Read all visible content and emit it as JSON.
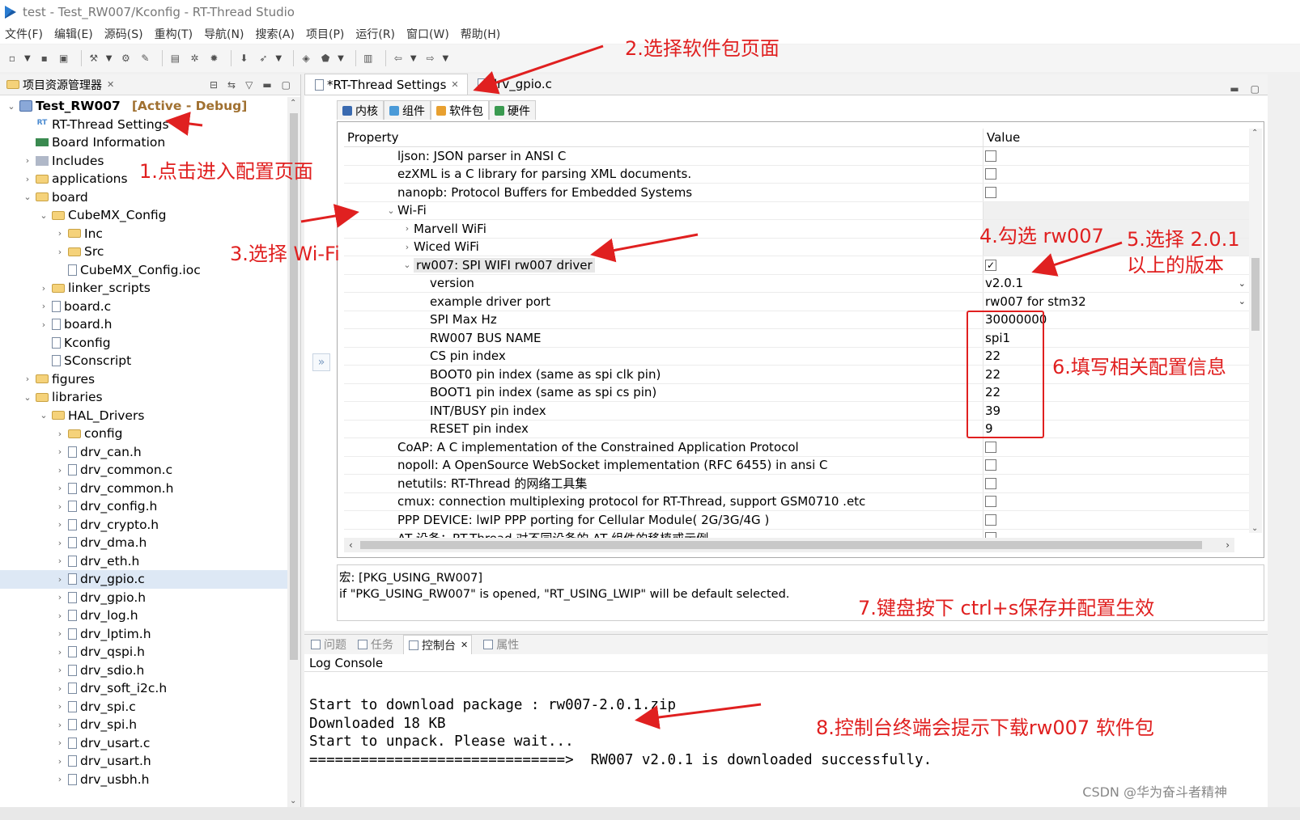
{
  "window": {
    "title": "test - Test_RW007/Kconfig - RT-Thread Studio"
  },
  "menubar": [
    "文件(F)",
    "编辑(E)",
    "源码(S)",
    "重构(T)",
    "导航(N)",
    "搜索(A)",
    "项目(P)",
    "运行(R)",
    "窗口(W)",
    "帮助(H)"
  ],
  "explorer": {
    "title": "项目资源管理器",
    "project_name": "Test_RW007",
    "project_tag": "[Active - Debug]",
    "items": [
      {
        "label": "RT-Thread Settings",
        "icon": "rt-settings-icon",
        "depth": 1,
        "twist": ""
      },
      {
        "label": "Board Information",
        "icon": "board-info-icon",
        "depth": 1,
        "twist": ""
      },
      {
        "label": "Includes",
        "icon": "includes-icon",
        "depth": 1,
        "twist": "›"
      },
      {
        "label": "applications",
        "icon": "folder-icon",
        "depth": 1,
        "twist": "›"
      },
      {
        "label": "board",
        "icon": "folder-icon",
        "depth": 1,
        "twist": "⌄"
      },
      {
        "label": "CubeMX_Config",
        "icon": "folder-icon",
        "depth": 2,
        "twist": "⌄"
      },
      {
        "label": "Inc",
        "icon": "folder-icon",
        "depth": 3,
        "twist": "›"
      },
      {
        "label": "Src",
        "icon": "folder-icon",
        "depth": 3,
        "twist": "›"
      },
      {
        "label": "CubeMX_Config.ioc",
        "icon": "file-icon",
        "depth": 3,
        "twist": ""
      },
      {
        "label": "linker_scripts",
        "icon": "folder-icon",
        "depth": 2,
        "twist": "›"
      },
      {
        "label": "board.c",
        "icon": "file-icon",
        "depth": 2,
        "twist": "›"
      },
      {
        "label": "board.h",
        "icon": "file-icon",
        "depth": 2,
        "twist": "›"
      },
      {
        "label": "Kconfig",
        "icon": "file-icon",
        "depth": 2,
        "twist": ""
      },
      {
        "label": "SConscript",
        "icon": "file-icon",
        "depth": 2,
        "twist": ""
      },
      {
        "label": "figures",
        "icon": "folder-icon",
        "depth": 1,
        "twist": "›"
      },
      {
        "label": "libraries",
        "icon": "folder-icon",
        "depth": 1,
        "twist": "⌄"
      },
      {
        "label": "HAL_Drivers",
        "icon": "folder-icon",
        "depth": 2,
        "twist": "⌄"
      },
      {
        "label": "config",
        "icon": "folder-icon",
        "depth": 3,
        "twist": "›"
      },
      {
        "label": "drv_can.h",
        "icon": "file-icon",
        "depth": 3,
        "twist": "›"
      },
      {
        "label": "drv_common.c",
        "icon": "file-icon",
        "depth": 3,
        "twist": "›"
      },
      {
        "label": "drv_common.h",
        "icon": "file-icon",
        "depth": 3,
        "twist": "›"
      },
      {
        "label": "drv_config.h",
        "icon": "file-icon",
        "depth": 3,
        "twist": "›"
      },
      {
        "label": "drv_crypto.h",
        "icon": "file-icon",
        "depth": 3,
        "twist": "›"
      },
      {
        "label": "drv_dma.h",
        "icon": "file-icon",
        "depth": 3,
        "twist": "›"
      },
      {
        "label": "drv_eth.h",
        "icon": "file-icon",
        "depth": 3,
        "twist": "›"
      },
      {
        "label": "drv_gpio.c",
        "icon": "file-icon",
        "depth": 3,
        "twist": "›",
        "selected": true
      },
      {
        "label": "drv_gpio.h",
        "icon": "file-icon",
        "depth": 3,
        "twist": "›"
      },
      {
        "label": "drv_log.h",
        "icon": "file-icon",
        "depth": 3,
        "twist": "›"
      },
      {
        "label": "drv_lptim.h",
        "icon": "file-icon",
        "depth": 3,
        "twist": "›"
      },
      {
        "label": "drv_qspi.h",
        "icon": "file-icon",
        "depth": 3,
        "twist": "›"
      },
      {
        "label": "drv_sdio.h",
        "icon": "file-icon",
        "depth": 3,
        "twist": "›"
      },
      {
        "label": "drv_soft_i2c.h",
        "icon": "file-icon",
        "depth": 3,
        "twist": "›"
      },
      {
        "label": "drv_spi.c",
        "icon": "file-icon",
        "depth": 3,
        "twist": "›"
      },
      {
        "label": "drv_spi.h",
        "icon": "file-icon",
        "depth": 3,
        "twist": "›"
      },
      {
        "label": "drv_usart.c",
        "icon": "file-icon",
        "depth": 3,
        "twist": "›"
      },
      {
        "label": "drv_usart.h",
        "icon": "file-icon",
        "depth": 3,
        "twist": "›"
      },
      {
        "label": "drv_usbh.h",
        "icon": "file-icon",
        "depth": 3,
        "twist": "›"
      }
    ]
  },
  "editor": {
    "tabs": [
      {
        "label": "*RT-Thread Settings",
        "active": true
      },
      {
        "label": "drv_gpio.c",
        "active": false
      }
    ],
    "sub_tabs": [
      {
        "label": "内核",
        "color": "#3a6ab0"
      },
      {
        "label": "组件",
        "color": "#4a9ad8"
      },
      {
        "label": "软件包",
        "color": "#e8a030",
        "active": true
      },
      {
        "label": "硬件",
        "color": "#3a9a50"
      }
    ],
    "prop_header": {
      "property": "Property",
      "value": "Value"
    },
    "rows": [
      {
        "label": "ljson: JSON parser in ANSI C",
        "indent": 2,
        "value_type": "checkbox",
        "checked": false
      },
      {
        "label": "ezXML is a C library for parsing XML documents.",
        "indent": 2,
        "value_type": "checkbox",
        "checked": false
      },
      {
        "label": "nanopb: Protocol Buffers for Embedded Systems",
        "indent": 2,
        "value_type": "checkbox",
        "checked": false
      },
      {
        "label": "Wi-Fi",
        "indent": 2,
        "twist": "⌄",
        "value_type": "grey"
      },
      {
        "label": "Marvell WiFi",
        "indent": 3,
        "twist": "›",
        "value_type": "grey"
      },
      {
        "label": "Wiced WiFi",
        "indent": 3,
        "twist": "›",
        "value_type": "grey"
      },
      {
        "label": "rw007: SPI WIFI rw007 driver",
        "indent": 3,
        "twist": "⌄",
        "value_type": "checkbox",
        "checked": true,
        "highlight": true
      },
      {
        "label": "version",
        "indent": 4,
        "value_type": "dropdown",
        "value": "v2.0.1"
      },
      {
        "label": "example driver port",
        "indent": 4,
        "value_type": "dropdown",
        "value": "rw007 for stm32"
      },
      {
        "label": "SPI Max Hz",
        "indent": 4,
        "value_type": "text",
        "value": "30000000"
      },
      {
        "label": "RW007 BUS NAME",
        "indent": 4,
        "value_type": "text",
        "value": "spi1"
      },
      {
        "label": "CS pin index",
        "indent": 4,
        "value_type": "text",
        "value": "22"
      },
      {
        "label": "BOOT0 pin index (same as spi clk pin)",
        "indent": 4,
        "value_type": "text",
        "value": "22"
      },
      {
        "label": "BOOT1 pin index (same as spi cs pin)",
        "indent": 4,
        "value_type": "text",
        "value": "22"
      },
      {
        "label": "INT/BUSY pin index",
        "indent": 4,
        "value_type": "text",
        "value": "39"
      },
      {
        "label": "RESET pin index",
        "indent": 4,
        "value_type": "text",
        "value": "9"
      },
      {
        "label": "CoAP: A C implementation of the Constrained Application Protocol",
        "indent": 2,
        "value_type": "checkbox",
        "checked": false
      },
      {
        "label": "nopoll: A OpenSource WebSocket implementation (RFC 6455) in ansi C",
        "indent": 2,
        "value_type": "checkbox",
        "checked": false
      },
      {
        "label": "netutils:  RT-Thread 的网络工具集",
        "indent": 2,
        "value_type": "checkbox",
        "checked": false
      },
      {
        "label": "cmux: connection multiplexing protocol for RT-Thread, support GSM0710 .etc",
        "indent": 2,
        "value_type": "checkbox",
        "checked": false
      },
      {
        "label": "PPP DEVICE: lwIP PPP porting for Cellular Module( 2G/3G/4G )",
        "indent": 2,
        "value_type": "checkbox",
        "checked": false
      },
      {
        "label": "AT 设备：RT-Thread 对不同设备的 AT 组件的移植或示例",
        "indent": 2,
        "value_type": "checkbox",
        "checked": false
      }
    ],
    "description": {
      "line1": "宏: [PKG_USING_RW007]",
      "line2": "if \"PKG_USING_RW007\" is opened, \"RT_USING_LWIP\" will be default selected."
    }
  },
  "console": {
    "tabs": [
      {
        "label": "问题",
        "active": false
      },
      {
        "label": "任务",
        "active": false
      },
      {
        "label": "控制台",
        "active": true
      },
      {
        "label": "属性",
        "active": false
      }
    ],
    "title": "Log Console",
    "lines": [
      "Start to download package : rw007-2.0.1.zip",
      "Downloaded 18 KB",
      "Start to unpack. Please wait...",
      "==============================>  RW007 v2.0.1 is downloaded successfully."
    ],
    "watermark": "CSDN @华为奋斗者精神"
  },
  "annotations": {
    "a1": "1.点击进入配置页面",
    "a2": "2.选择软件包页面",
    "a3": "3.选择 Wi-Fi",
    "a4": "4.勾选 rw007",
    "a5_line1": "5.选择 2.0.1",
    "a5_line2": "以上的版本",
    "a6": "6.填写相关配置信息",
    "a7": "7.键盘按下 ctrl+s保存并配置生效",
    "a8": "8.控制台终端会提示下载rw007 软件包",
    "color": "#e02020"
  }
}
